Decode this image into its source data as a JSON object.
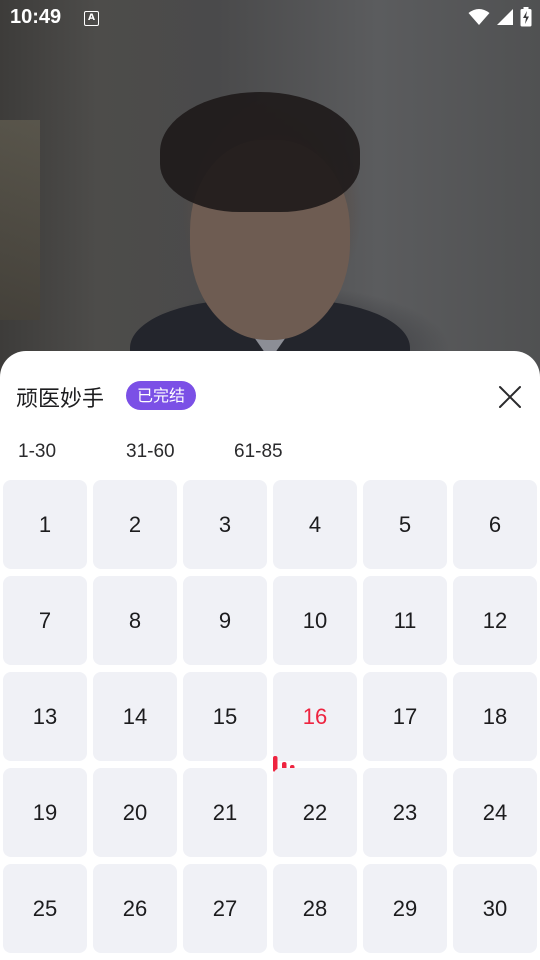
{
  "status_bar": {
    "time": "10:49",
    "notification_icon_letter": "A"
  },
  "sheet": {
    "title": "顽医妙手",
    "status_tag": "已完结",
    "close_icon": "close-icon"
  },
  "range_tabs": [
    {
      "label": "1-30"
    },
    {
      "label": "31-60"
    },
    {
      "label": "61-85"
    }
  ],
  "episodes": [
    "1",
    "2",
    "3",
    "4",
    "5",
    "6",
    "7",
    "8",
    "9",
    "10",
    "11",
    "12",
    "13",
    "14",
    "15",
    "16",
    "17",
    "18",
    "19",
    "20",
    "21",
    "22",
    "23",
    "24",
    "25",
    "26",
    "27",
    "28",
    "29",
    "30"
  ],
  "current_episode": "16",
  "colors": {
    "accent_tag": "#7b50e6",
    "current_episode": "#ee2440",
    "tile_bg": "#f0f1f6"
  }
}
